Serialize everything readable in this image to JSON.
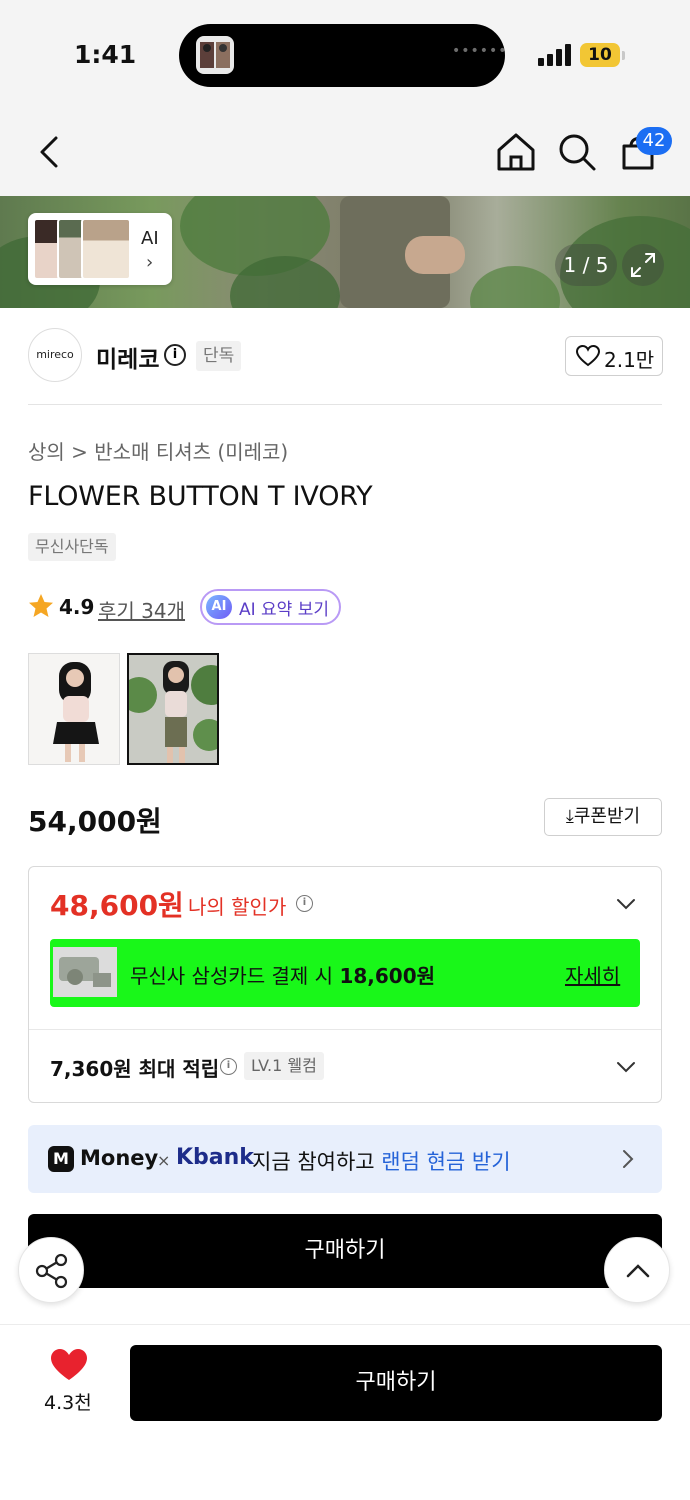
{
  "status_bar": {
    "time": "1:41",
    "battery": "10"
  },
  "nav": {
    "cart_count": "42"
  },
  "hero": {
    "ai_label": "AI",
    "page_indicator": "1 / 5"
  },
  "brand": {
    "logo_text": "mireco",
    "name": "미레코",
    "tag": "단독",
    "likes": "2.1만"
  },
  "product": {
    "breadcrumb": "상의 > 반소매 티셔츠 (미레코)",
    "title": "FLOWER BUTTON T IVORY",
    "tag": "무신사단독",
    "rating": "4.9",
    "reviews": "후기 34개",
    "ai_badge": "AI",
    "ai_summary": "AI 요약 보기",
    "price": "54,000원",
    "coupon": "쿠폰받기"
  },
  "discount": {
    "price": "48,600원",
    "label": "나의 할인가",
    "card_text": "무신사 삼성카드 결제 시 ",
    "card_amount": "18,600원",
    "card_detail": "자세히",
    "points": "7,360원 최대 적립",
    "level": "LV.1 웰컴"
  },
  "promo": {
    "money": "Money",
    "x": "×",
    "kbank": "Kbank",
    "text": "지금 참여하고 ",
    "highlight": "랜덤 현금 받기"
  },
  "actions": {
    "buy_inline": "구매하기",
    "buy_bottom": "구매하기",
    "wish_count": "4.3천"
  },
  "colors": {
    "discount_red": "#e33125",
    "card_green": "#19f719",
    "cart_badge": "#1b6ef3",
    "ai_purple": "#5b3ec7",
    "promo_bg": "#e8effc"
  }
}
